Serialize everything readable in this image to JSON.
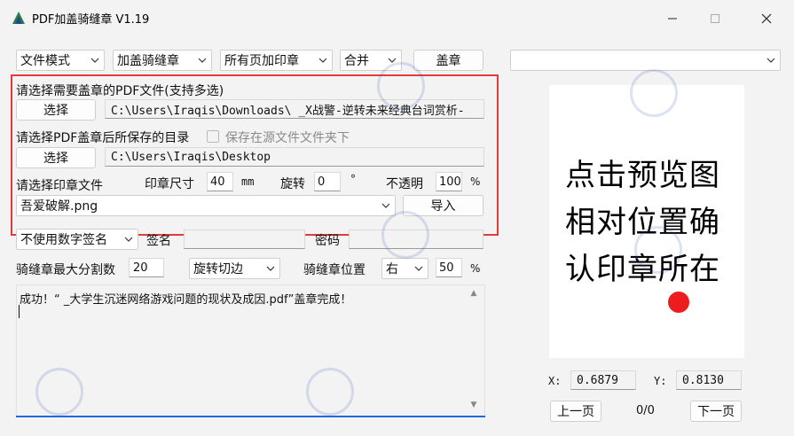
{
  "window": {
    "title": "PDF加盖骑缝章 V1.19"
  },
  "toolbar": {
    "mode_select": "文件模式",
    "stamp_type_select": "加盖骑缝章",
    "page_select": "所有页加印章",
    "merge_select": "合并",
    "stamp_button": "盖章"
  },
  "input_section": {
    "pdf_prompt": "请选择需要盖章的PDF文件(支持多选)",
    "pdf_select_button": "选择",
    "pdf_path": "C:\\Users\\Iraqis\\Downloads\\  _X战警-逆转未来经典台词赏析-",
    "output_prompt": "请选择PDF盖章后所保存的目录",
    "save_in_source_checkbox_label": "保存在源文件文件夹下",
    "output_select_button": "选择",
    "output_path": "C:\\Users\\Iraqis\\Desktop",
    "stamp_file_prompt": "请选择印章文件",
    "stamp_size_label": "印章尺寸",
    "stamp_size_value": "40",
    "stamp_size_unit": "mm",
    "rotate_label": "旋转",
    "rotate_value": "0",
    "rotate_unit": "°",
    "opacity_label": "不透明",
    "opacity_value": "100",
    "opacity_unit": "%",
    "stamp_file_select": "吾爱破解.png",
    "import_button": "导入"
  },
  "signature": {
    "digital_sig_select": "不使用数字签名",
    "sign_label": "签名",
    "sign_value": "",
    "password_label": "密码",
    "password_value": ""
  },
  "seam": {
    "max_split_label": "骑缝章最大分割数",
    "max_split_value": "20",
    "rotate_cut_select": "旋转切边",
    "position_label": "骑缝章位置",
    "position_select": "右",
    "position_value": "50",
    "position_unit": "%"
  },
  "log": {
    "message": "成功！“  _大学生沉迷网络游戏问题的现状及成因.pdf”盖章完成！"
  },
  "preview": {
    "top_select": "",
    "hint_line1": "点击预览图",
    "hint_line2": "相对位置确",
    "hint_line3": "认印章所在",
    "x_label": "X:",
    "x_value": "0.6879",
    "y_label": "Y:",
    "y_value": "0.8130",
    "prev_button": "上一页",
    "page_indicator": "0/0",
    "next_button": "下一页"
  },
  "colors": {
    "highlight_box": "#e23b3b",
    "stamp_dot": "#ee1d1d",
    "log_underline": "#1f6ad8"
  }
}
